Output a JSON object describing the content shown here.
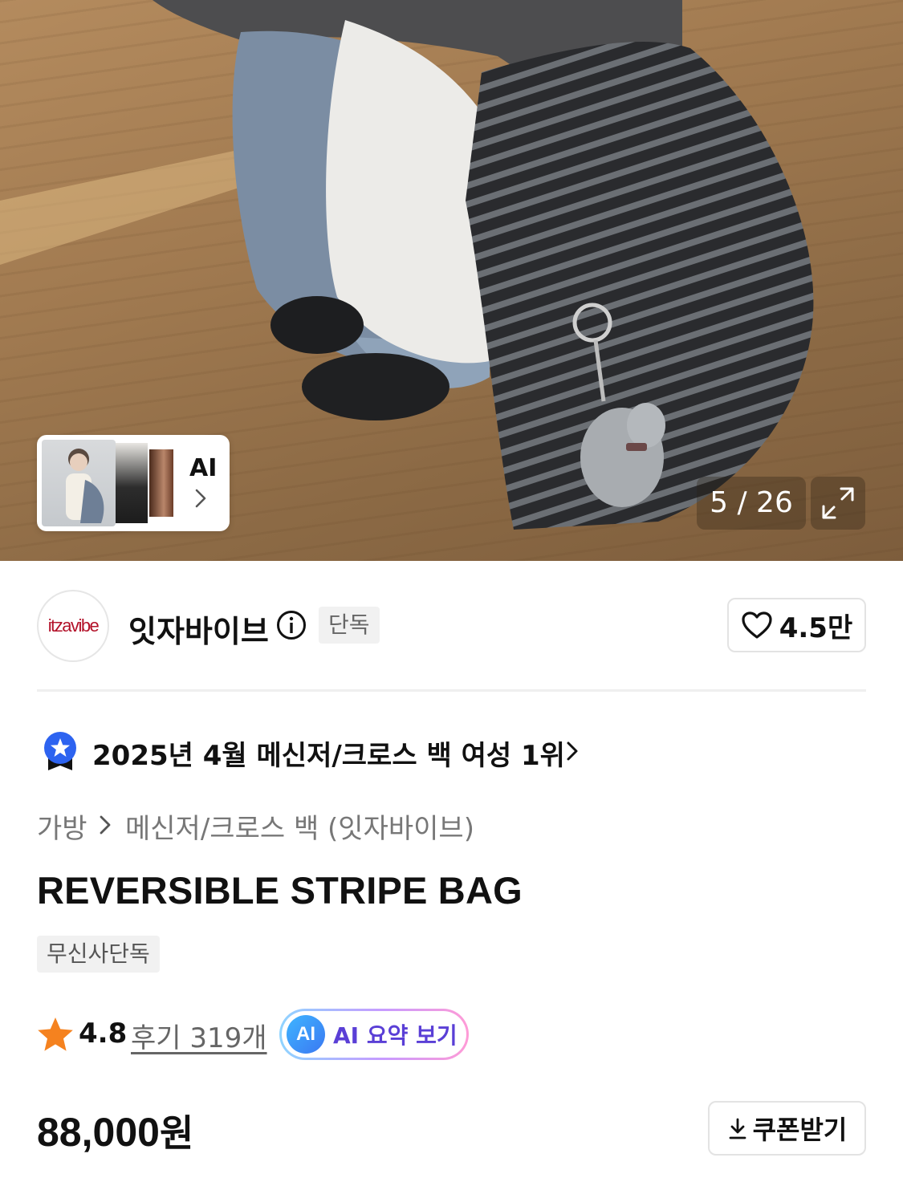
{
  "gallery": {
    "counter": "5 / 26",
    "ai_card_label": "AI"
  },
  "brand": {
    "logo_text": "itzavibe",
    "name": "잇자바이브",
    "exclusive_badge": "단독",
    "like_count": "4.5만"
  },
  "ranking": {
    "text": "2025년 4월 메신저/크로스 백 여성 1위"
  },
  "breadcrumb": {
    "category": "가방",
    "subcategory": "메신저/크로스 백 (잇자바이브)"
  },
  "product": {
    "title": "REVERSIBLE STRIPE BAG",
    "tag": "무신사단독"
  },
  "rating": {
    "score": "4.8",
    "review_label": "후기 319개",
    "ai_badge": "AI",
    "ai_summary_label": "AI 요약 보기",
    "star_color": "#f5821f"
  },
  "price": {
    "amount": "88,000",
    "currency": "원"
  },
  "coupon": {
    "label": "쿠폰받기"
  },
  "icons": [
    "expand-icon",
    "chevron-right-icon",
    "info-icon",
    "heart-icon",
    "ranking-medal-icon",
    "star-icon",
    "download-icon"
  ]
}
